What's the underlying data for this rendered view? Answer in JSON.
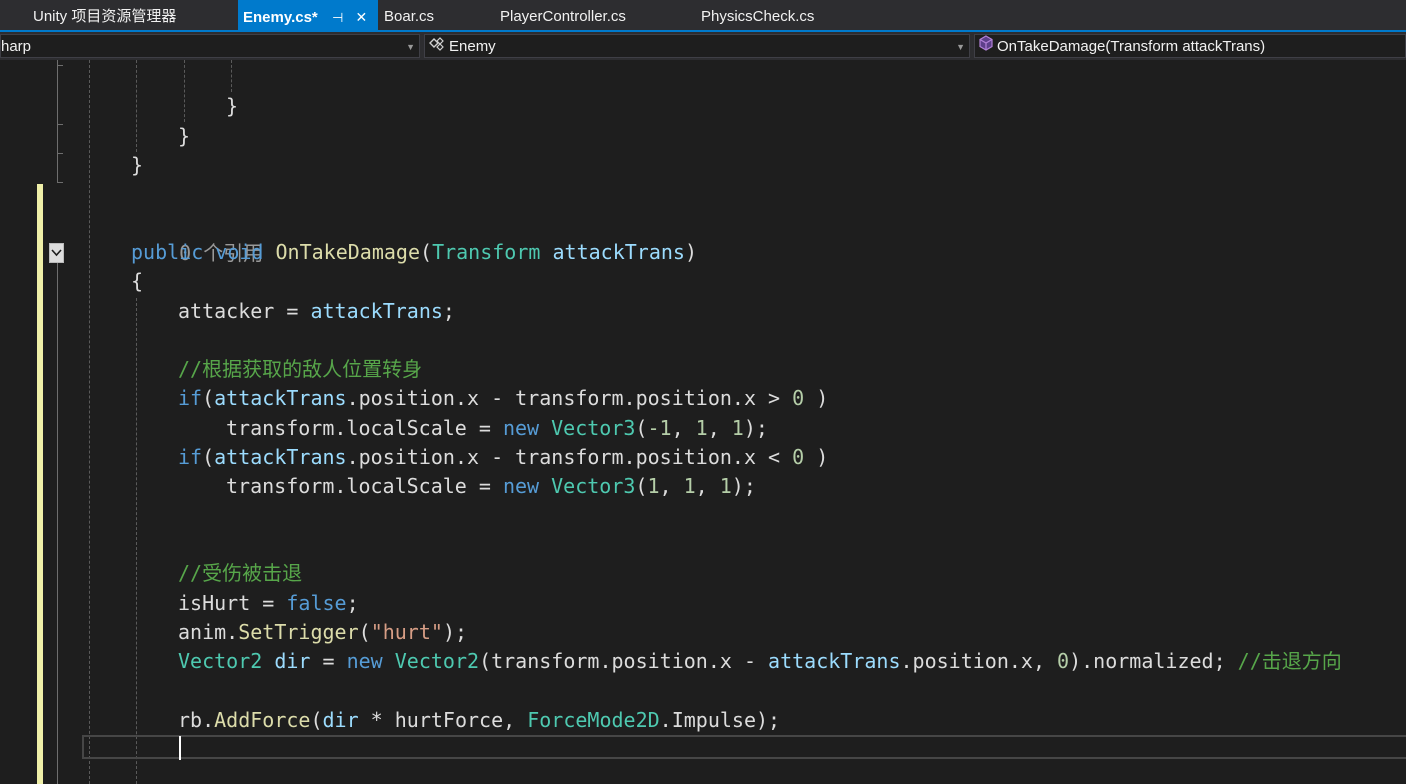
{
  "tabs": [
    {
      "label": "Unity 项目资源管理器",
      "active": false
    },
    {
      "label": "Enemy.cs*",
      "active": true,
      "pin_glyph": "⊣",
      "close_glyph": "✕"
    },
    {
      "label": "Boar.cs",
      "active": false
    },
    {
      "label": "PlayerController.cs",
      "active": false
    },
    {
      "label": "PhysicsCheck.cs",
      "active": false
    }
  ],
  "navbar": {
    "project": "harp",
    "class_name": "Enemy",
    "class_icon": "class-icon",
    "member_name": "OnTakeDamage(Transform attackTrans)",
    "member_icon": "method-cube-icon",
    "dropdown_glyph": "▼"
  },
  "editor": {
    "codelens_refs": "0 个引用",
    "lines": [
      {
        "tokens": [
          {
            "t": "}",
            "c": "plain"
          }
        ]
      },
      {
        "tokens": [
          {
            "t": "}",
            "c": "plain"
          }
        ]
      },
      {
        "tokens": [
          {
            "t": "}",
            "c": "plain"
          }
        ]
      },
      {
        "tokens": [
          {
            "t": "public",
            "c": "kw"
          },
          {
            "t": " ",
            "c": "plain"
          },
          {
            "t": "void",
            "c": "kw"
          },
          {
            "t": " ",
            "c": "plain"
          },
          {
            "t": "OnTakeDamage",
            "c": "method"
          },
          {
            "t": "(",
            "c": "plain"
          },
          {
            "t": "Transform",
            "c": "type"
          },
          {
            "t": " ",
            "c": "plain"
          },
          {
            "t": "attackTrans",
            "c": "member"
          },
          {
            "t": ")",
            "c": "plain"
          }
        ]
      },
      {
        "tokens": [
          {
            "t": "{",
            "c": "plain"
          }
        ]
      },
      {
        "tokens": [
          {
            "t": "attacker",
            "c": "plain"
          },
          {
            "t": " = ",
            "c": "plain"
          },
          {
            "t": "attackTrans",
            "c": "member"
          },
          {
            "t": ";",
            "c": "plain"
          }
        ]
      },
      {
        "tokens": [
          {
            "t": "//根据获取的敌人位置转身",
            "c": "comment"
          }
        ]
      },
      {
        "tokens": [
          {
            "t": "if",
            "c": "kw"
          },
          {
            "t": "(",
            "c": "plain"
          },
          {
            "t": "attackTrans",
            "c": "member"
          },
          {
            "t": ".position.x - transform.position.x > ",
            "c": "plain"
          },
          {
            "t": "0",
            "c": "num"
          },
          {
            "t": " )",
            "c": "plain"
          }
        ]
      },
      {
        "tokens": [
          {
            "t": "transform.localScale = ",
            "c": "plain"
          },
          {
            "t": "new",
            "c": "kw"
          },
          {
            "t": " ",
            "c": "plain"
          },
          {
            "t": "Vector3",
            "c": "type"
          },
          {
            "t": "(",
            "c": "plain"
          },
          {
            "t": "-1",
            "c": "num"
          },
          {
            "t": ", ",
            "c": "plain"
          },
          {
            "t": "1",
            "c": "num"
          },
          {
            "t": ", ",
            "c": "plain"
          },
          {
            "t": "1",
            "c": "num"
          },
          {
            "t": ");",
            "c": "plain"
          }
        ]
      },
      {
        "tokens": [
          {
            "t": "if",
            "c": "kw"
          },
          {
            "t": "(",
            "c": "plain"
          },
          {
            "t": "attackTrans",
            "c": "member"
          },
          {
            "t": ".position.x - transform.position.x < ",
            "c": "plain"
          },
          {
            "t": "0",
            "c": "num"
          },
          {
            "t": " )",
            "c": "plain"
          }
        ]
      },
      {
        "tokens": [
          {
            "t": "transform.localScale = ",
            "c": "plain"
          },
          {
            "t": "new",
            "c": "kw"
          },
          {
            "t": " ",
            "c": "plain"
          },
          {
            "t": "Vector3",
            "c": "type"
          },
          {
            "t": "(",
            "c": "plain"
          },
          {
            "t": "1",
            "c": "num"
          },
          {
            "t": ", ",
            "c": "plain"
          },
          {
            "t": "1",
            "c": "num"
          },
          {
            "t": ", ",
            "c": "plain"
          },
          {
            "t": "1",
            "c": "num"
          },
          {
            "t": ");",
            "c": "plain"
          }
        ]
      },
      {
        "tokens": [
          {
            "t": "//受伤被击退",
            "c": "comment"
          }
        ]
      },
      {
        "tokens": [
          {
            "t": "isHurt = ",
            "c": "plain"
          },
          {
            "t": "false",
            "c": "kw"
          },
          {
            "t": ";",
            "c": "plain"
          }
        ]
      },
      {
        "tokens": [
          {
            "t": "anim.",
            "c": "plain"
          },
          {
            "t": "SetTrigger",
            "c": "method"
          },
          {
            "t": "(",
            "c": "plain"
          },
          {
            "t": "\"hurt\"",
            "c": "str"
          },
          {
            "t": ");",
            "c": "plain"
          }
        ]
      },
      {
        "tokens": [
          {
            "t": "Vector2",
            "c": "type"
          },
          {
            "t": " ",
            "c": "plain"
          },
          {
            "t": "dir",
            "c": "member"
          },
          {
            "t": " = ",
            "c": "plain"
          },
          {
            "t": "new",
            "c": "kw"
          },
          {
            "t": " ",
            "c": "plain"
          },
          {
            "t": "Vector2",
            "c": "type"
          },
          {
            "t": "(transform.position.x - ",
            "c": "plain"
          },
          {
            "t": "attackTrans",
            "c": "member"
          },
          {
            "t": ".position.x, ",
            "c": "plain"
          },
          {
            "t": "0",
            "c": "num"
          },
          {
            "t": ").normalized; ",
            "c": "plain"
          },
          {
            "t": "//击退方向",
            "c": "comment"
          }
        ]
      },
      {
        "tokens": [
          {
            "t": "rb.",
            "c": "plain"
          },
          {
            "t": "AddForce",
            "c": "method"
          },
          {
            "t": "(",
            "c": "plain"
          },
          {
            "t": "dir",
            "c": "member"
          },
          {
            "t": " * hurtForce, ",
            "c": "plain"
          },
          {
            "t": "ForceMode2D",
            "c": "type"
          },
          {
            "t": ".Impulse);",
            "c": "plain"
          }
        ]
      }
    ]
  },
  "colors": {
    "keyword": "#569cd6",
    "type": "#4ec9b0",
    "method": "#dcdcaa",
    "member": "#9cdcfe",
    "comment": "#57a64a",
    "number": "#b5cea8",
    "string": "#d69d85",
    "plain": "#dcdcdc",
    "accent": "#007acc",
    "change_bar": "#efefa8"
  }
}
